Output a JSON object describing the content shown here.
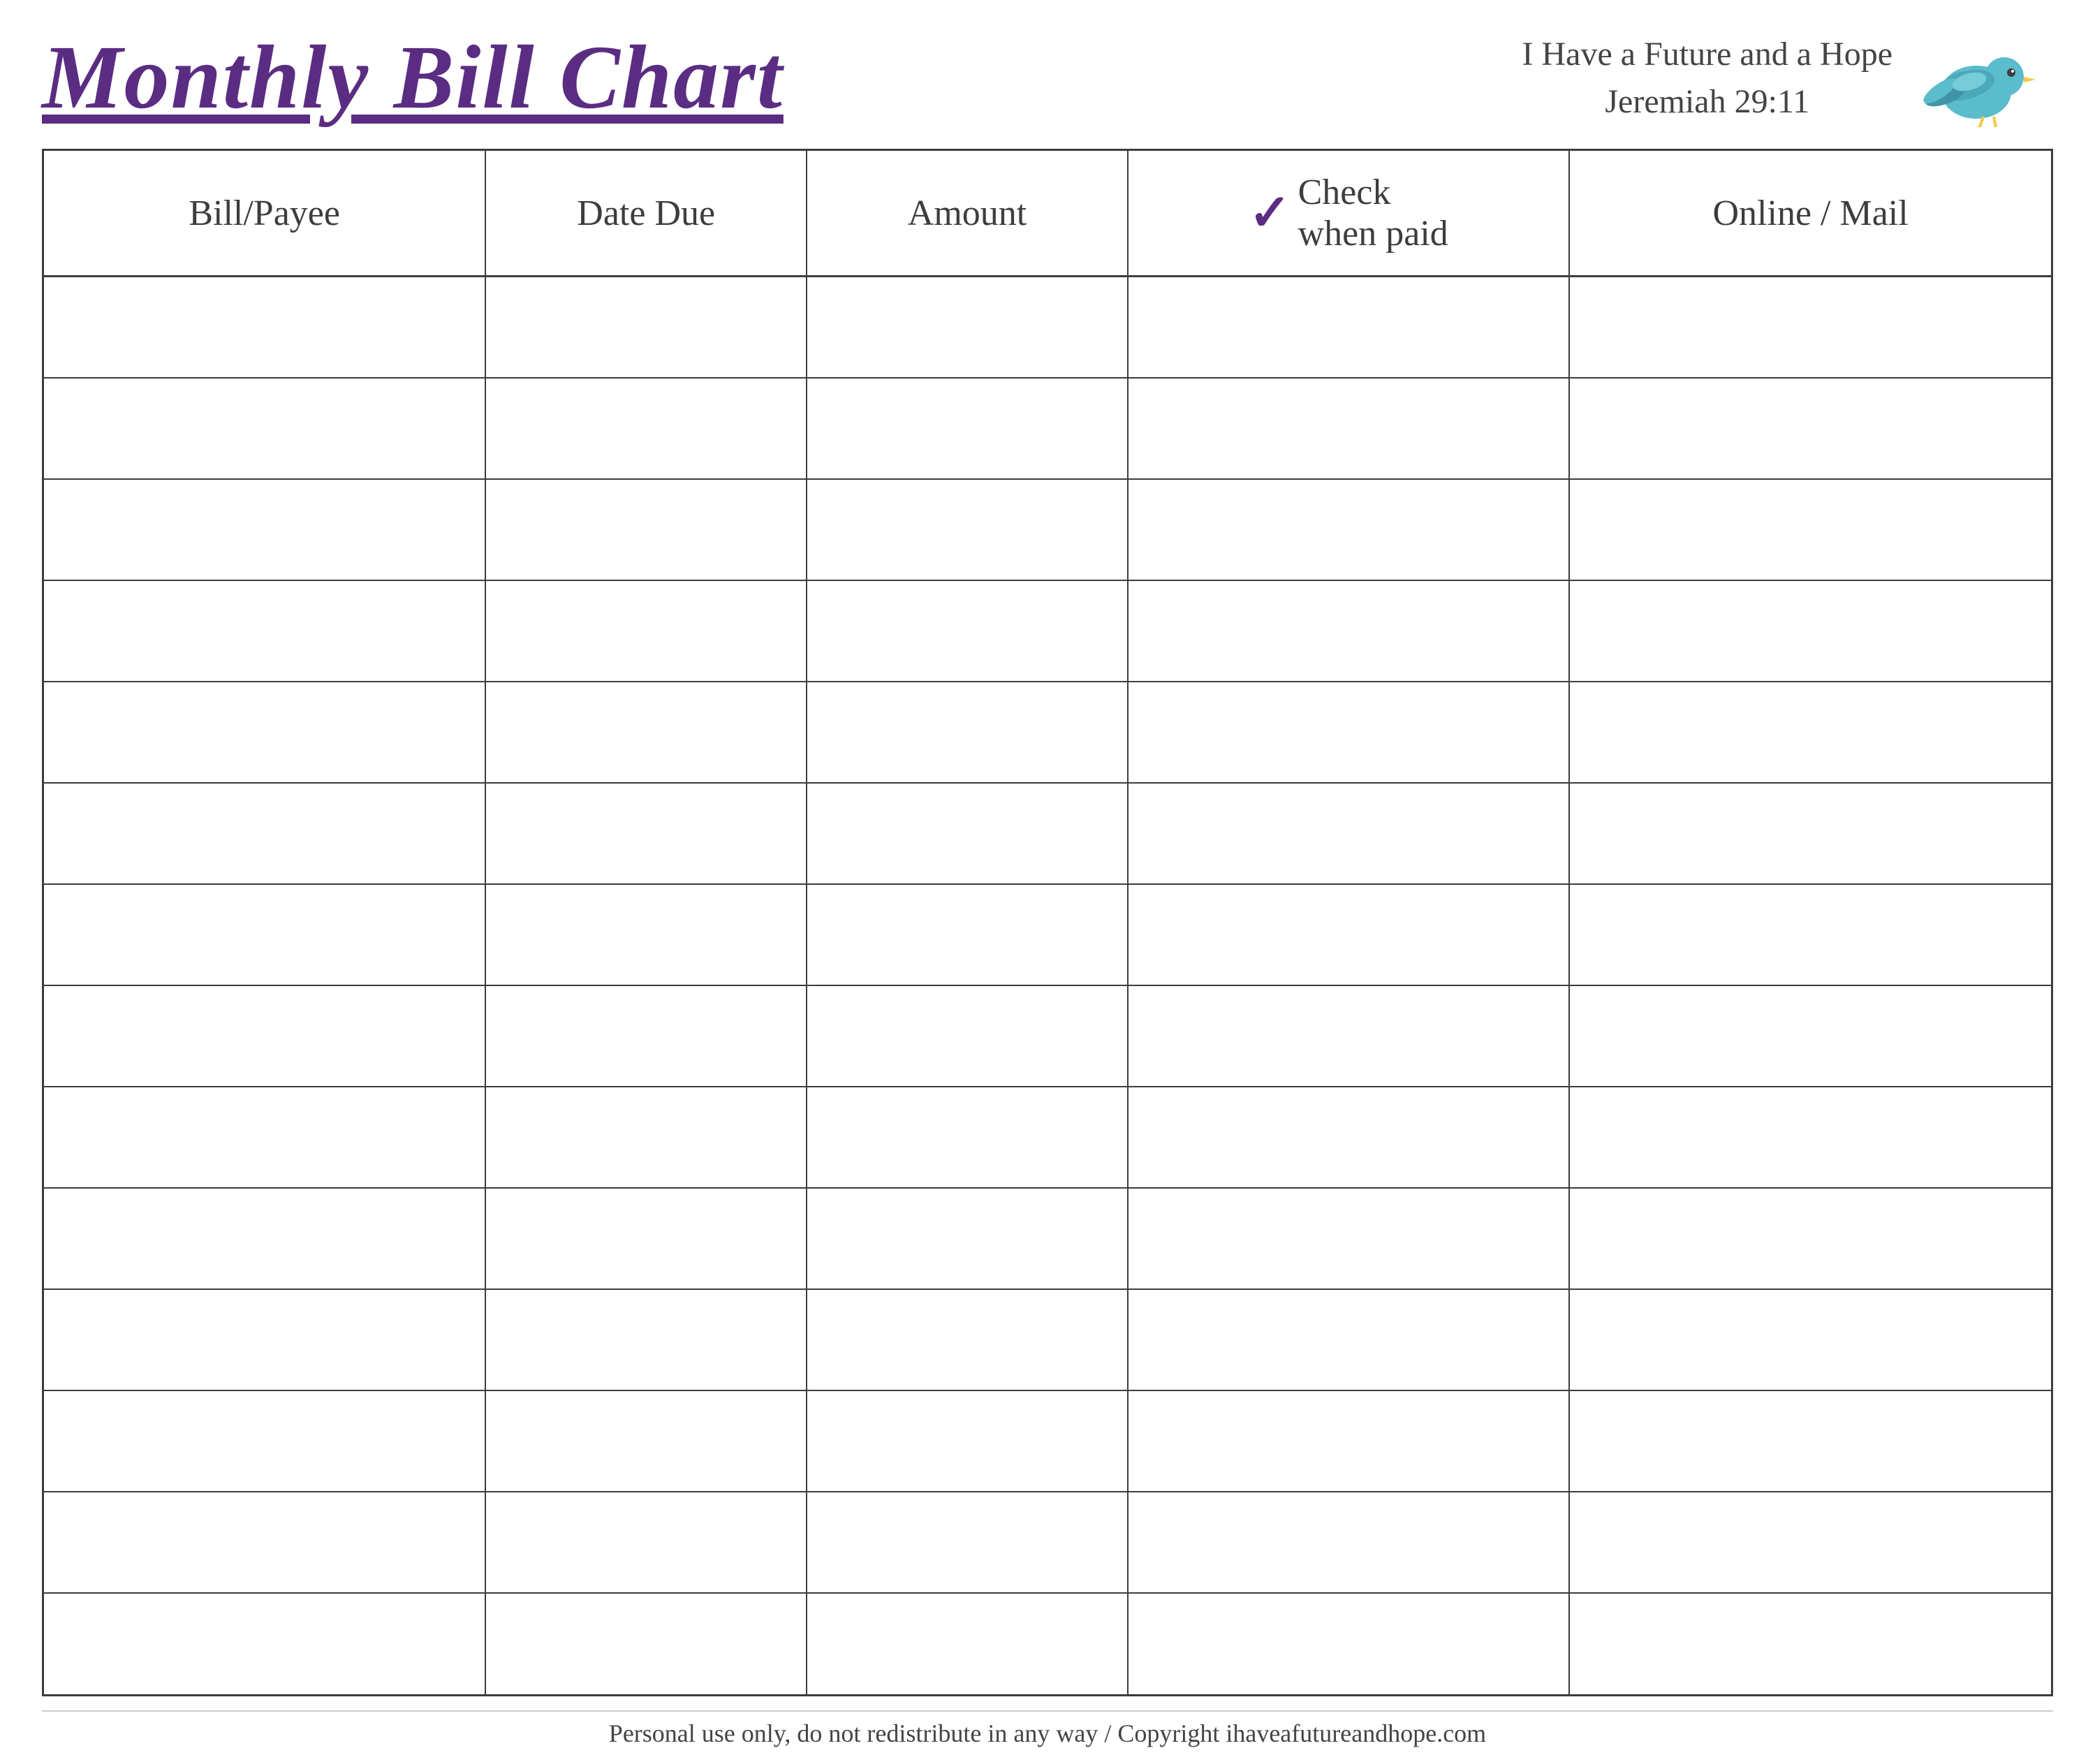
{
  "header": {
    "title": "Monthly Bill Chart",
    "subtitle_line1": "I Have a Future and a Hope",
    "subtitle_line2": "Jeremiah 29:11"
  },
  "table": {
    "columns": [
      {
        "label": "Bill/Payee",
        "class": "bill-col"
      },
      {
        "label": "Date Due",
        "class": "date-col"
      },
      {
        "label": "Amount",
        "class": "amount-col"
      },
      {
        "label_check": "Check",
        "label_paid": "when paid",
        "class": "check-col"
      },
      {
        "label": "Online / Mail",
        "class": "online-col"
      }
    ],
    "row_count": 14
  },
  "footer": {
    "text": "Personal use only, do not redistribute in any way / Copyright ihaveafutureandhope.com"
  }
}
